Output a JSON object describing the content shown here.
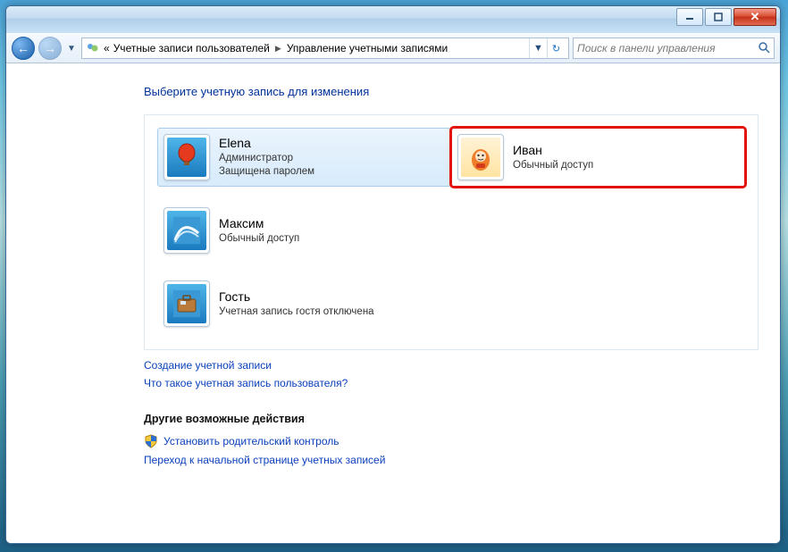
{
  "breadcrumb": {
    "prefix": "«",
    "item1": "Учетные записи пользователей",
    "item2": "Управление учетными записями"
  },
  "search": {
    "placeholder": "Поиск в панели управления"
  },
  "page": {
    "title": "Выберите учетную запись для изменения"
  },
  "accounts": [
    {
      "name": "Elena",
      "line1": "Администратор",
      "line2": "Защищена паролем"
    },
    {
      "name": "Иван",
      "line1": "Обычный доступ",
      "line2": ""
    },
    {
      "name": "Максим",
      "line1": "Обычный доступ",
      "line2": ""
    },
    {
      "name": "Гость",
      "line1": "Учетная запись гостя отключена",
      "line2": ""
    }
  ],
  "links": {
    "create": "Создание учетной записи",
    "whatis": "Что такое учетная запись пользователя?",
    "parental": "Установить родительский контроль",
    "home": "Переход к начальной странице учетных записей"
  },
  "section": {
    "other": "Другие возможные действия"
  }
}
